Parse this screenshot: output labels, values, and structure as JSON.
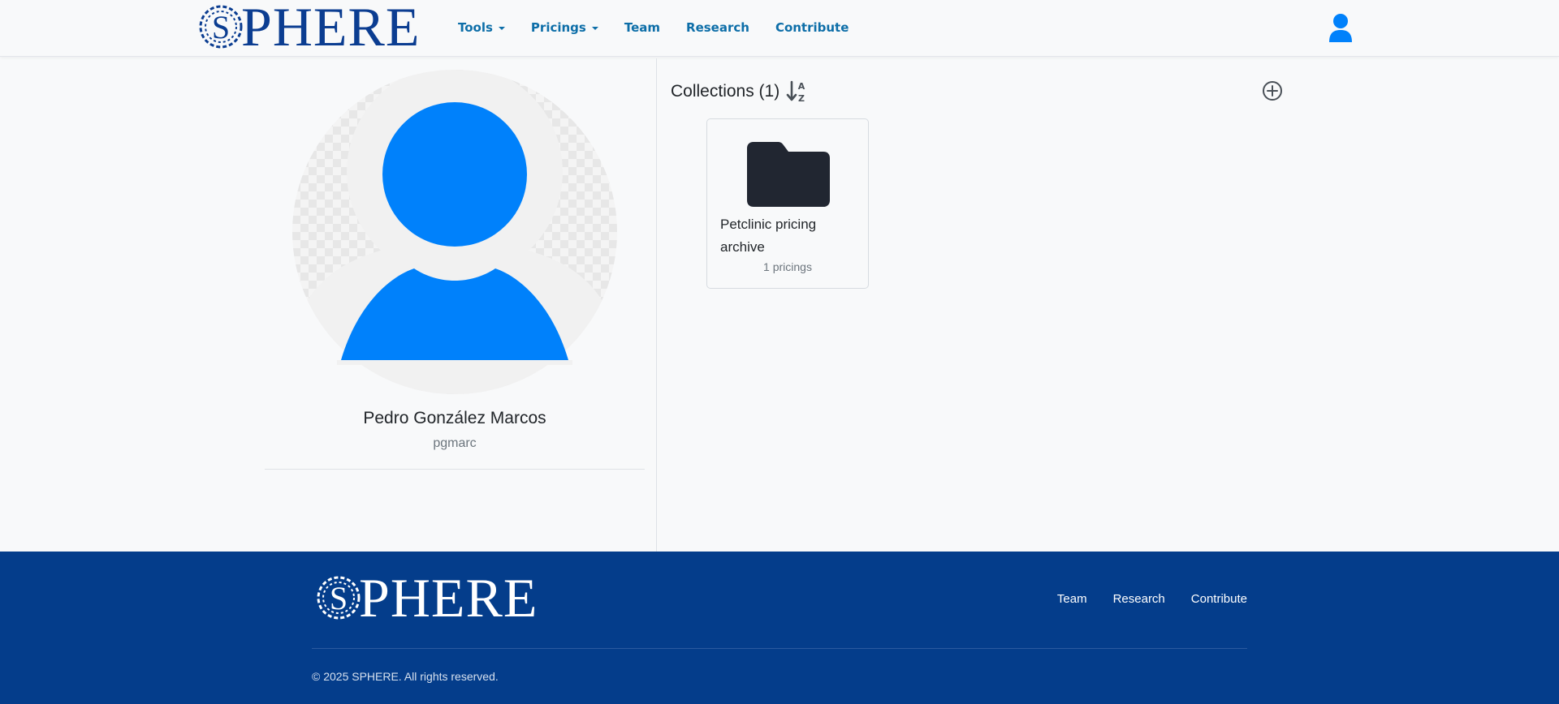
{
  "brand": {
    "name": "PHERE",
    "mark": "S"
  },
  "nav": {
    "items": [
      {
        "label": "Tools",
        "dropdown": true
      },
      {
        "label": "Pricings",
        "dropdown": true
      },
      {
        "label": "Team",
        "dropdown": false
      },
      {
        "label": "Research",
        "dropdown": false
      },
      {
        "label": "Contribute",
        "dropdown": false
      }
    ],
    "user_icon": "user-icon"
  },
  "profile": {
    "name": "Pedro González Marcos",
    "username": "pgmarc"
  },
  "collections": {
    "title": "Collections (1)",
    "sort_icon": "sort-alpha-down-icon",
    "add_icon": "plus-circle-icon",
    "items": [
      {
        "name": "Petclinic pricing archive",
        "count_label": "1 pricings",
        "icon": "folder-icon"
      }
    ]
  },
  "footer": {
    "links": [
      "Team",
      "Research",
      "Contribute"
    ],
    "copyright": "© 2025 SPHERE. All rights reserved."
  },
  "colors": {
    "accent": "#0d6ea8",
    "brand_blue": "#0b3d91",
    "avatar_blue": "#0081fb",
    "footer_bg": "#043d8b",
    "folder": "#212631"
  }
}
